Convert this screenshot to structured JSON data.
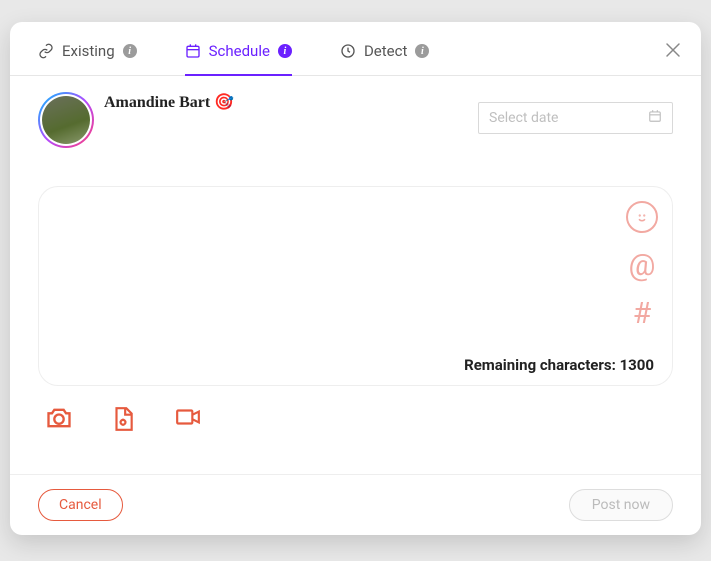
{
  "tabs": {
    "existing": "Existing",
    "schedule": "Schedule",
    "detect": "Detect"
  },
  "user": {
    "name": "Amandine Bart 🎯"
  },
  "datepicker": {
    "placeholder": "Select date"
  },
  "composer": {
    "remaining_label": "Remaining characters:",
    "remaining_count": "1300"
  },
  "footer": {
    "cancel": "Cancel",
    "post": "Post now"
  }
}
